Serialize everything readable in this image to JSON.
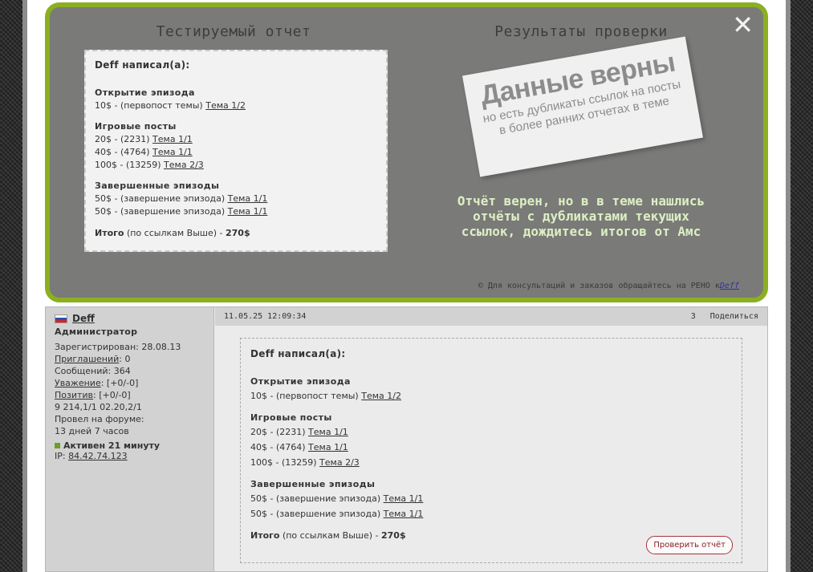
{
  "modal": {
    "close_glyph": "✕",
    "left_heading": "Тестируемый отчет",
    "right_heading": "Результаты проверки",
    "stamp": {
      "main": "Данные верны",
      "line1": "но есть дубликаты ссылок на посты",
      "line2": "в более ранних отчетах в теме"
    },
    "verdict": {
      "line1": "Отчёт верен, но в в теме нашлись",
      "line2": "отчёты с дубликатами текущих",
      "line3": "ссылок, дождитесь итогов от Амс"
    },
    "footer_text": "© Для консультаций и заказов обращайтесь на РЕНО к",
    "footer_link": "Deff"
  },
  "report": {
    "header": "Deff написал(а):",
    "sections": [
      {
        "title": "Открытие эпизода",
        "lines": [
          {
            "text": "10$ - (первопост темы)",
            "link": "Тема 1/2"
          }
        ]
      },
      {
        "title": "Игровые посты",
        "lines": [
          {
            "text": "20$ - (2231)",
            "link": "Тема 1/1"
          },
          {
            "text": "40$ - (4764)",
            "link": "Тема 1/1"
          },
          {
            "text": "100$ - (13259)",
            "link": "Тема 2/3"
          }
        ]
      },
      {
        "title": "Завершенные эпизоды",
        "lines": [
          {
            "text": "50$ - (завершение эпизода)",
            "link": "Тема 1/1"
          },
          {
            "text": "50$ - (завершение эпизода)",
            "link": "Тема 1/1"
          }
        ]
      }
    ],
    "total_label": "Итого",
    "total_note": "(по ссылкам Выше) -",
    "total_value": "270$"
  },
  "post": {
    "author": {
      "name": "Deff",
      "role": "Администратор",
      "registered": "Зарегистрирован: 28.08.13",
      "invites_label": "Приглашений",
      "invites_value": ": 0",
      "messages": "Сообщений: 364",
      "respect_label": "Уважение",
      "respect_value": ": [+0/-0]",
      "positive_label": "Позитив",
      "positive_value": ": [+0/-0]",
      "stats": "9 214,1/1 02.20,2/1",
      "forum_time_label": "Провел на форуме:",
      "forum_time_value": "13 дней 7 часов",
      "active": "Активен 21 минуту",
      "ip_label": "IP:",
      "ip_value": "84.42.74.123"
    },
    "timestamp": "11.05.25 12:09:34",
    "post_number": "3",
    "share_label": "Поделиться",
    "check_button": "Проверить отчёт"
  },
  "colors": {
    "modal_bg": "#7a7a78",
    "modal_border": "#8ab020",
    "verdict_text": "#dcefc3",
    "active_dot": "#6aa125",
    "check_button": "#a8343a"
  }
}
